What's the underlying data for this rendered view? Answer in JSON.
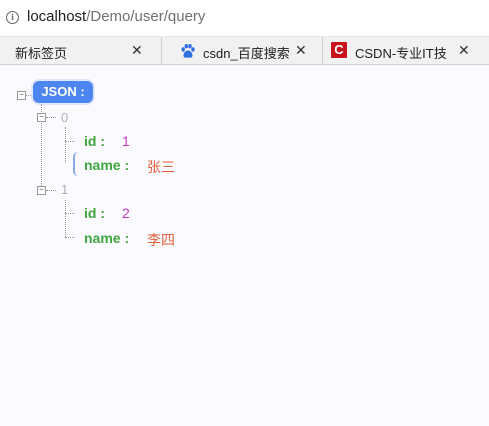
{
  "address_bar": {
    "host": "localhost",
    "path": "/Demo/user/query"
  },
  "tabs": [
    {
      "label": "新标签页"
    },
    {
      "label": "csdn_百度搜索"
    },
    {
      "label": "CSDN-专业IT技"
    }
  ],
  "json_view": {
    "root_label": "JSON :",
    "items": [
      {
        "index": "0",
        "id_key": "id :",
        "id_value": "1",
        "name_key": "name :",
        "name_value": "张三"
      },
      {
        "index": "1",
        "id_key": "id :",
        "id_value": "2",
        "name_key": "name :",
        "name_value": "李四"
      }
    ]
  },
  "colors": {
    "key": "#3fa53f",
    "number": "#c238c2",
    "string": "#e06038",
    "root_badge": "#4d86f0"
  }
}
